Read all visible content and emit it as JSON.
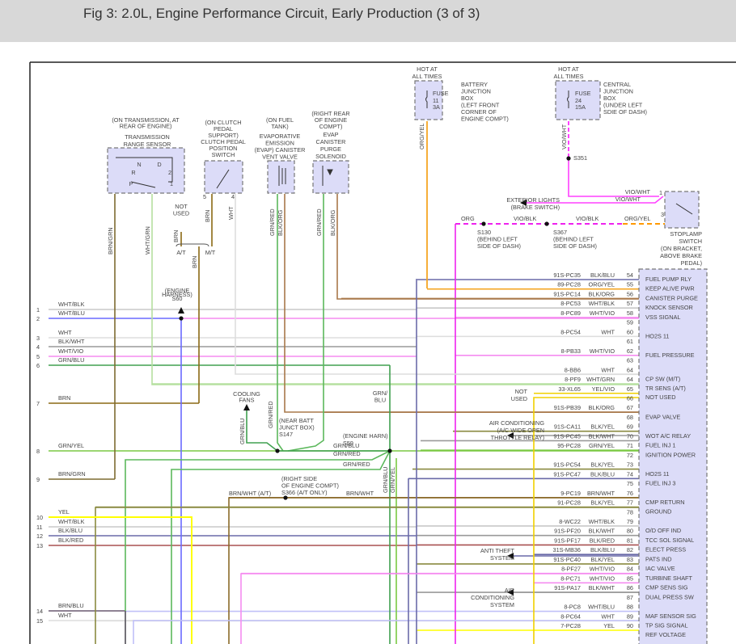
{
  "header": {
    "title": "Fig 3: 2.0L, Engine Performance Circuit, Early Production (3 of 3)"
  },
  "wire_colors": {
    "BLK/BLU": "#6a6aa8",
    "ORG/YEL": "#f5a623",
    "BLK/ORG": "#a8784a",
    "WHT/BLK": "#c8c8c8",
    "WHT/VIO": "#f58cf0",
    "WHT": "#dddddd",
    "WHT/GRN": "#b5e0a0",
    "YEL/VIO": "#f0d000",
    "BLK/YEL": "#8a8a40",
    "BLK/WHT": "#9a9a9a",
    "GRN/YEL": "#7ac943",
    "BRN/WHT": "#8b6a2a",
    "BLK/RED": "#a85050",
    "WHT/BLU": "#c0c0f8",
    "YEL": "#ffff00",
    "GRN/BLU": "#40a050",
    "BRN": "#8b6914",
    "BRN/GRN": "#7d6b30",
    "GRN/RED": "#5cb85c",
    "VIO/WHT": "#ff40ff",
    "VIO/BLK": "#ee22ee",
    "ORG": "#ff9900",
    "BRN/BLU": "#6a5a70",
    "WHT/BLU2": "#6a6aff",
    "connector_fill": "#dcdcf8"
  },
  "components": {
    "fuse11": {
      "hot": [
        "HOT AT",
        "ALL TIMES"
      ],
      "label": "FUSE",
      "num": "11",
      "amp": "3A",
      "box": [
        "BATTERY",
        "JUNCTION",
        "BOX",
        "(LEFT FRONT",
        "CORNER OF",
        "ENGINE COMPT)"
      ]
    },
    "fuse24": {
      "hot": [
        "HOT AT",
        "ALL TIMES"
      ],
      "label": "FUSE",
      "num": "24",
      "amp": "15A",
      "box": [
        "CENTRAL",
        "JUNCTION",
        "BOX",
        "(UNDER LEFT",
        "SDIE OF DASH)"
      ]
    },
    "trs": {
      "location": [
        "(ON TRANSMISSION, AT",
        "REAR OF ENGINE)"
      ],
      "name": [
        "TRANSMISSION",
        "RANGE SENSOR"
      ],
      "positions": {
        "n": "N",
        "d": "D",
        "r": "R",
        "two": "2",
        "p": "P",
        "one": "1"
      }
    },
    "cpp": {
      "location": [
        "(ON CLUTCH",
        "PEDAL",
        "SUPPORT)"
      ],
      "name": [
        "CLUTCH PEDAL",
        "POSITION",
        "SWITCH"
      ],
      "pin_a": "5",
      "pin_b": "4"
    },
    "vent": {
      "location": [
        "(ON FUEL",
        "TANK)"
      ],
      "name": [
        "EVAPORATIVE",
        "EMISSION",
        "(EVAP) CANISTER",
        "VENT VALVE"
      ]
    },
    "purge": {
      "location": [
        "(RIGHT REAR",
        "OF ENGINE",
        "COMPT)"
      ],
      "name": [
        "EVAP",
        "CANISTER",
        "PURGE",
        "SOLENOID"
      ]
    },
    "stoplamp": {
      "name": [
        "STOPLAMP",
        "SWITCH",
        "(ON BRACKET,",
        "ABOVE BRAKE",
        "PEDAL)"
      ],
      "pin_a": "1",
      "pin_b": "3"
    }
  },
  "wire_labels": {
    "org_yel_v": "ORG/YEL",
    "vio_wht_v": "VIO/WHT",
    "vio_wht_1": "VIO/WHT",
    "vio_wht_2": "VIO/WHT",
    "org": "ORG",
    "vio_blk_1": "VIO/BLK",
    "vio_blk_2": "VIO/BLK",
    "org_yel_h": "ORG/YEL",
    "brn_grn_v": "BRN/GRN",
    "wht_grn_v": "WHT/GRN",
    "brn_nu": "BRN",
    "brn_cpp": "BRN",
    "wht_cpp": "WHT",
    "brn_bus": "BRN",
    "at": "A/T",
    "mt": "M/T",
    "not_used": [
      "NOT",
      "USED"
    ],
    "grn_red_vent": "GRN/RED",
    "blk_org_vent": "BLK/ORG",
    "grn_red_purge": "GRN/RED",
    "blk_org_purge": "BLK/ORG",
    "grn_blu_fans": "GRN/BLU",
    "grn_red_s147": "GRN/RED",
    "grn_blu_h": "GRN/BLU",
    "grn_red_h1": "GRN/RED",
    "grn_red_h2": "GRN/RED",
    "grn_blu_top": [
      "GRN/",
      "BLU"
    ],
    "grn_blu_s59": "GRN/BLU",
    "grn_yel_s59": "GRN/YEL",
    "brn_wht_at": "BRN/WHT  (A/T)",
    "brn_wht_r": "BRN/WHT"
  },
  "splices": {
    "s351": "S351",
    "s130": [
      "S130",
      "(BEHIND LEFT",
      "SIDE OF DASH)"
    ],
    "s367": [
      "S367",
      "(BEHIND LEFT",
      "SIDE OF DASH)"
    ],
    "s60": [
      "(ENGINE",
      "HARNESS)",
      "S60"
    ],
    "s147": [
      "(NEAR BATT",
      "JUNCT BOX)",
      "S147"
    ],
    "s59": [
      "(ENGINE HARN)",
      "S59"
    ],
    "s366": [
      "(RIGHT SIDE",
      "OF ENGINE COMPT)",
      "S366  (A/T ONLY)"
    ]
  },
  "destinations": {
    "exterior_lights": [
      "EXTERIOR LIGHTS",
      "(BRAKE SWITCH)"
    ],
    "cooling_fans": [
      "COOLING",
      "FANS"
    ],
    "not_used": [
      "NOT",
      "USED"
    ],
    "ac_relay": [
      "AIR CONDITIONING",
      "(A/C WIDE OPEN",
      "THROTTLE RELAY)"
    ],
    "anti_theft": [
      "ANTI THEFT",
      "SYSTEM"
    ],
    "ac_system": [
      "AIR",
      "CONDITIONING",
      "SYSTEM"
    ]
  },
  "left_rows": [
    {
      "n": "1",
      "color": "WHT/BLK"
    },
    {
      "n": "2",
      "color": "WHT/BLU"
    },
    {
      "n": "3",
      "color": "WHT"
    },
    {
      "n": "4",
      "color": "BLK/WHT"
    },
    {
      "n": "5",
      "color": "WHT/VIO"
    },
    {
      "n": "6",
      "color": "GRN/BLU"
    },
    {
      "n": "7",
      "color": "BRN"
    },
    {
      "n": "8",
      "color": "GRN/YEL"
    },
    {
      "n": "9",
      "color": "BRN/GRN"
    },
    {
      "n": "10",
      "color": "YEL"
    },
    {
      "n": "11",
      "color": "WHT/BLK"
    },
    {
      "n": "12",
      "color": "BLK/BLU"
    },
    {
      "n": "13",
      "color": "BLK/RED"
    },
    {
      "n": "14",
      "color": "BRN/BLU"
    },
    {
      "n": "15",
      "color": "WHT"
    }
  ],
  "pcm": {
    "pins": [
      {
        "pin": "54",
        "circuit": "91S-PC35",
        "color": "BLK/BLU"
      },
      {
        "pin": "55",
        "circuit": "89-PC28",
        "color": "ORG/YEL"
      },
      {
        "pin": "56",
        "circuit": "91S-PC14",
        "color": "BLK/ORG"
      },
      {
        "pin": "57",
        "circuit": "8-PC53",
        "color": "WHT/BLK"
      },
      {
        "pin": "58",
        "circuit": "8-PC89",
        "color": "WHT/VIO"
      },
      {
        "pin": "59",
        "circuit": "",
        "color": ""
      },
      {
        "pin": "60",
        "circuit": "8-PC54",
        "color": "WHT"
      },
      {
        "pin": "61",
        "circuit": "",
        "color": ""
      },
      {
        "pin": "62",
        "circuit": "8-PB33",
        "color": "WHT/VIO"
      },
      {
        "pin": "63",
        "circuit": "",
        "color": ""
      },
      {
        "pin": "64",
        "circuit": "8-BB6",
        "color": "WHT"
      },
      {
        "pin": "64",
        "circuit": "8-PF9",
        "color": "WHT/GRN"
      },
      {
        "pin": "65",
        "circuit": "33-XL65",
        "color": "YEL/VIO"
      },
      {
        "pin": "66",
        "circuit": "",
        "color": ""
      },
      {
        "pin": "67",
        "circuit": "91S-PB39",
        "color": "BLK/ORG"
      },
      {
        "pin": "68",
        "circuit": "",
        "color": ""
      },
      {
        "pin": "69",
        "circuit": "91S-CA11",
        "color": "BLK/YEL"
      },
      {
        "pin": "70",
        "circuit": "91S-PC45",
        "color": "BLK/WHT"
      },
      {
        "pin": "71",
        "circuit": "95-PC28",
        "color": "GRN/YEL"
      },
      {
        "pin": "72",
        "circuit": "",
        "color": ""
      },
      {
        "pin": "73",
        "circuit": "91S-PC54",
        "color": "BLK/YEL"
      },
      {
        "pin": "74",
        "circuit": "91S-PC47",
        "color": "BLK/BLU"
      },
      {
        "pin": "75",
        "circuit": "",
        "color": ""
      },
      {
        "pin": "76",
        "circuit": "9-PC19",
        "color": "BRN/WHT"
      },
      {
        "pin": "77",
        "circuit": "91-PC28",
        "color": "BLK/YEL"
      },
      {
        "pin": "78",
        "circuit": "",
        "color": ""
      },
      {
        "pin": "79",
        "circuit": "8-WC22",
        "color": "WHT/BLK"
      },
      {
        "pin": "80",
        "circuit": "91S-PF20",
        "color": "BLK/WHT"
      },
      {
        "pin": "81",
        "circuit": "91S-PF17",
        "color": "BLK/RED"
      },
      {
        "pin": "82",
        "circuit": "31S-MB36",
        "color": "BLK/BLU"
      },
      {
        "pin": "83",
        "circuit": "91S-PC40",
        "color": "BLK/YEL"
      },
      {
        "pin": "84",
        "circuit": "8-PF27",
        "color": "WHT/VIO"
      },
      {
        "pin": "85",
        "circuit": "8-PC71",
        "color": "WHT/VIO"
      },
      {
        "pin": "86",
        "circuit": "91S-PA17",
        "color": "BLK/WHT"
      },
      {
        "pin": "87",
        "circuit": "",
        "color": ""
      },
      {
        "pin": "88",
        "circuit": "8-PC8",
        "color": "WHT/BLU"
      },
      {
        "pin": "89",
        "circuit": "8-PC64",
        "color": "WHT"
      },
      {
        "pin": "90",
        "circuit": "7-PC28",
        "color": "YEL"
      }
    ],
    "functions": [
      "FUEL PUMP RLY",
      "KEEP ALIVE PWR",
      "CANISTER PURGE",
      "KNOCK SENSOR",
      "VSS SIGNAL",
      "HO2S 11",
      "FUEL PRESSURE",
      "CP SW (M/T)",
      "TR SENS (A/T)",
      "NOT USED",
      "EVAP VALVE",
      "WOT A/C RELAY",
      "FUEL INJ 1",
      "IGNITION POWER",
      "HO2S 11",
      "FUEL INJ 3",
      "CMP RETURN",
      "GROUND",
      "O/D OFF IND",
      "TCC SOL SIGNAL",
      "ELECT PRESS",
      "PATS IND",
      "IAC VALVE",
      "TURBINE SHAFT",
      "CMP SENS SIG",
      "DUAL PRESS SW",
      "MAF SENSOR SIG",
      "TP SIG SIGNAL",
      "REF VOLTAGE"
    ]
  }
}
